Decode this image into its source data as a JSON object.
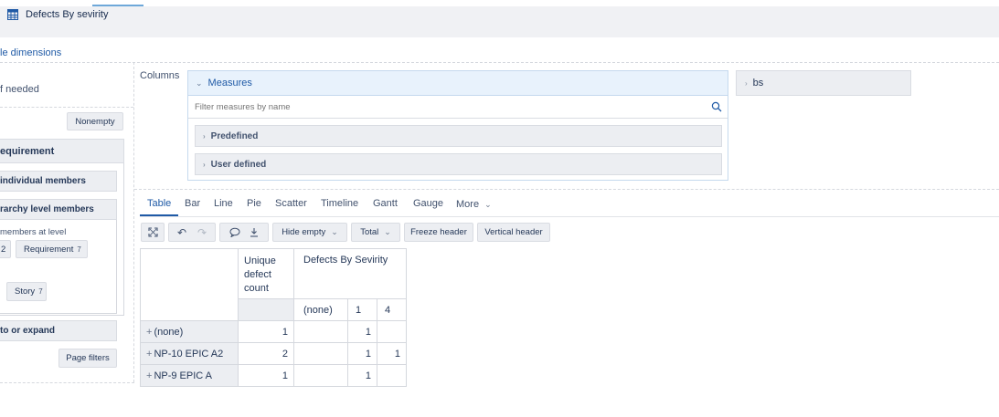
{
  "header": {
    "title": "Defects By sevirity",
    "icon": "table-icon"
  },
  "dimensions_link": "le dimensions",
  "left_panel": {
    "partial_top": "",
    "partial_needed": "f needed",
    "nonempty_label": "Nonempty",
    "requirement_header": "equirement",
    "individual_members": "individual members",
    "hierarchy_level_members": "rarchy level members",
    "members_at_level": "members at level",
    "chip_partial_count": "2",
    "requirement_chip": {
      "label": "Requirement",
      "count": "7"
    },
    "story_chip": {
      "label": "Story",
      "count": "7"
    },
    "zoom_expand": "to or expand",
    "page_filters": "Page filters"
  },
  "columns": {
    "label": "Columns",
    "measures_title": "Measures",
    "filter_placeholder": "Filter measures by name",
    "groups": [
      "Predefined",
      "User defined"
    ],
    "bs_label": "bs"
  },
  "tabs": [
    "Table",
    "Bar",
    "Line",
    "Pie",
    "Scatter",
    "Timeline",
    "Gantt",
    "Gauge",
    "More"
  ],
  "active_tab": "Table",
  "toolbar": {
    "hide_empty": "Hide empty",
    "total": "Total",
    "freeze_header": "Freeze header",
    "vertical_header": "Vertical header"
  },
  "table": {
    "col_header_1": "Unique defect count",
    "col_header_group": "Defects By Sevirity",
    "sub_headers": [
      "(none)",
      "1",
      "4"
    ],
    "rows": [
      {
        "label": "(none)",
        "unique": "1",
        "none": "",
        "c1": "1",
        "c4": ""
      },
      {
        "label": "NP-10 EPIC A2",
        "unique": "2",
        "none": "",
        "c1": "1",
        "c4": "1"
      },
      {
        "label": "NP-9 EPIC A",
        "unique": "1",
        "none": "",
        "c1": "1",
        "c4": ""
      }
    ]
  },
  "colors": {
    "accent": "#1f5aa6",
    "header_bg": "#f0f1f4",
    "measures_bg": "#e8f2fc"
  }
}
